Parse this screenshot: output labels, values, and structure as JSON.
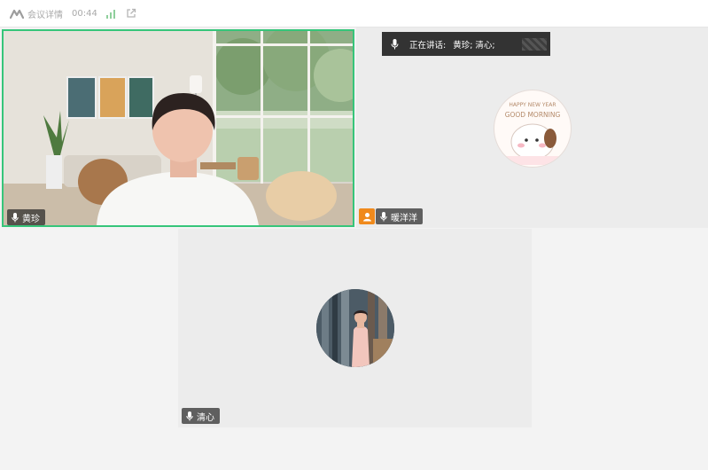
{
  "topbar": {
    "meeting_details": "会议详情",
    "duration": "00:44",
    "icons": [
      "brand-logo-icon",
      "signal-bars-icon",
      "share-external-icon"
    ]
  },
  "speaking_banner": {
    "label": "正在讲话:",
    "names": "黄珍; 清心;"
  },
  "participants": [
    {
      "name": "黄珍",
      "video": true,
      "active_speaker": true
    },
    {
      "name": "暖洋洋",
      "video": false,
      "host": true,
      "avatar_text": [
        "HAPPY NEW YEAR",
        "GOOD MORNING"
      ]
    },
    {
      "name": "清心",
      "video": false
    }
  ],
  "colors": {
    "active_border": "#36c57a",
    "host_badge": "#f08a1c",
    "tile_bg": "#ececec",
    "banner_bg": "#333333"
  }
}
